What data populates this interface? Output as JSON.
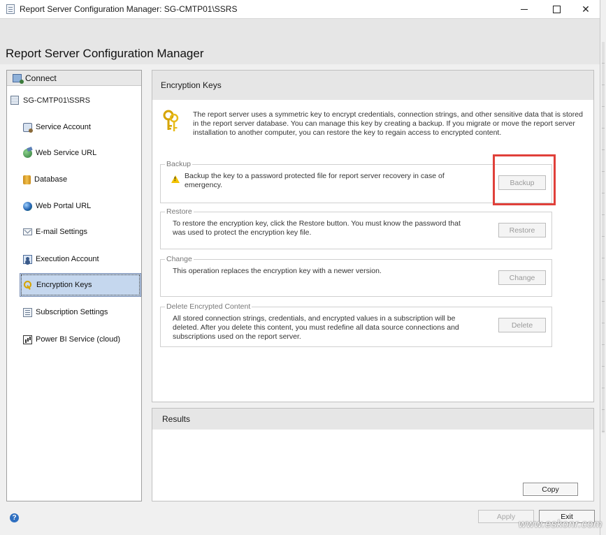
{
  "window": {
    "title": "Report Server Configuration Manager: SG-CMTP01\\SSRS",
    "heading": "Report Server Configuration Manager"
  },
  "sidebar": {
    "connect_label": "Connect",
    "server_name": "SG-CMTP01\\SSRS",
    "items": [
      {
        "label": "Service Account",
        "icon": "service-account-icon"
      },
      {
        "label": "Web Service URL",
        "icon": "web-service-url-icon"
      },
      {
        "label": "Database",
        "icon": "database-icon"
      },
      {
        "label": "Web Portal URL",
        "icon": "globe-icon"
      },
      {
        "label": "E-mail Settings",
        "icon": "mail-icon"
      },
      {
        "label": "Execution Account",
        "icon": "execution-account-icon"
      },
      {
        "label": "Encryption Keys",
        "icon": "key-icon",
        "selected": true
      },
      {
        "label": "Subscription Settings",
        "icon": "subscription-icon"
      },
      {
        "label": "Power BI Service (cloud)",
        "icon": "power-bi-icon"
      }
    ]
  },
  "main": {
    "title": "Encryption Keys",
    "intro": "The report server uses a symmetric key to encrypt credentials, connection strings, and other sensitive data that is stored in the report server database.  You can manage this key by creating a backup.  If you migrate or move the report server installation to another computer, you can restore the key to regain access to encrypted content.",
    "backup": {
      "legend": "Backup",
      "text": "Backup the key to a password protected file for report server recovery in case of emergency.",
      "button": "Backup"
    },
    "restore": {
      "legend": "Restore",
      "text": "To restore the encryption key, click the Restore button.  You must know the password that was used to protect the encryption key file.",
      "button": "Restore"
    },
    "change": {
      "legend": "Change",
      "text": "This operation replaces the encryption key with a newer version.",
      "button": "Change"
    },
    "delete": {
      "legend": "Delete Encrypted Content",
      "text": "All stored connection strings, credentials, and encrypted values in a subscription will be deleted.  After you delete this content, you must redefine all data source connections and subscriptions used on the report server.",
      "button": "Delete"
    }
  },
  "results": {
    "title": "Results",
    "copy_button": "Copy"
  },
  "footer": {
    "apply_button": "Apply",
    "exit_button": "Exit",
    "watermark": "www.eskonr.com"
  },
  "colors": {
    "selected_bg": "#c5d7ee",
    "highlight": "#e0403a",
    "panel_header": "#e6e6e6"
  }
}
